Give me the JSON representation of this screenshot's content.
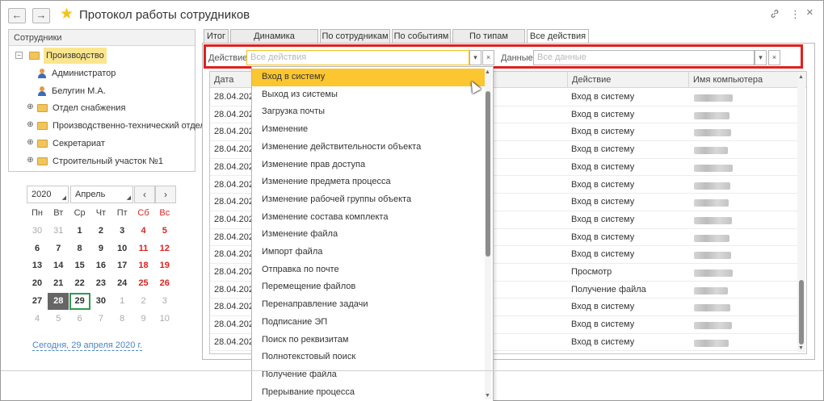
{
  "window": {
    "title": "Протокол работы сотрудников",
    "back_icon": "←",
    "forward_icon": "→",
    "link_icon": "🔗",
    "more_icon": "⋮",
    "close_icon": "×"
  },
  "tree": {
    "header": "Сотрудники",
    "items": [
      {
        "label": "Производство",
        "type": "folder",
        "expanded": true
      },
      {
        "label": "Администратор",
        "type": "user"
      },
      {
        "label": "Белугин М.А.",
        "type": "user"
      },
      {
        "label": "Отдел снабжения",
        "type": "folder"
      },
      {
        "label": "Производственно-технический отдел",
        "type": "folder"
      },
      {
        "label": "Секретариат",
        "type": "folder"
      },
      {
        "label": "Строительный участок №1",
        "type": "folder"
      }
    ]
  },
  "calendar": {
    "year": "2020",
    "month": "Апрель",
    "prev": "‹",
    "next": "›",
    "weekdays": [
      "Пн",
      "Вт",
      "Ср",
      "Чт",
      "Пт",
      "Сб",
      "Вс"
    ],
    "weeks": [
      [
        "30",
        "31",
        "1",
        "2",
        "3",
        "4",
        "5"
      ],
      [
        "6",
        "7",
        "8",
        "9",
        "10",
        "11",
        "12"
      ],
      [
        "13",
        "14",
        "15",
        "16",
        "17",
        "18",
        "19"
      ],
      [
        "20",
        "21",
        "22",
        "23",
        "24",
        "25",
        "26"
      ],
      [
        "27",
        "28",
        "29",
        "30",
        "1",
        "2",
        "3"
      ],
      [
        "4",
        "5",
        "6",
        "7",
        "8",
        "9",
        "10"
      ]
    ],
    "today_link": "Сегодня, 29 апреля 2020 г."
  },
  "tabs": [
    "Итог",
    "Динамика активности",
    "По сотрудникам",
    "По событиям",
    "По типам данных",
    "Все действия"
  ],
  "filters": {
    "action_label": "Действие:",
    "action_placeholder": "Все действия",
    "data_label": "Данные:",
    "data_placeholder": "Все данные",
    "dropdown_arrow": "▾",
    "clear": "×"
  },
  "table": {
    "columns": [
      "Дата",
      "Действие",
      "Имя компьютера"
    ],
    "rows": [
      {
        "date": "28.04.2020",
        "action": "Вход в систему"
      },
      {
        "date": "28.04.2020",
        "action": "Вход в систему"
      },
      {
        "date": "28.04.2020",
        "action": "Вход в систему"
      },
      {
        "date": "28.04.2020",
        "action": "Вход в систему"
      },
      {
        "date": "28.04.2020",
        "action": "Вход в систему"
      },
      {
        "date": "28.04.2020",
        "action": "Вход в систему"
      },
      {
        "date": "28.04.2020",
        "action": "Вход в систему"
      },
      {
        "date": "28.04.2020",
        "action": "Вход в систему"
      },
      {
        "date": "28.04.2020",
        "action": "Вход в систему"
      },
      {
        "date": "28.04.2020",
        "action": "Вход в систему"
      },
      {
        "date": "28.04.2020",
        "action": "Просмотр"
      },
      {
        "date": "28.04.2020",
        "action": "Получение файла"
      },
      {
        "date": "28.04.2020",
        "action": "Вход в систему"
      },
      {
        "date": "28.04.2020",
        "action": "Вход в систему"
      },
      {
        "date": "28.04.2020",
        "action": "Вход в систему"
      }
    ]
  },
  "dropdown": {
    "items": [
      "Вход в систему",
      "Выход из системы",
      "Загрузка почты",
      "Изменение",
      "Изменение действительности объекта",
      "Изменение прав доступа",
      "Изменение предмета процесса",
      "Изменение рабочей группы объекта",
      "Изменение состава комплекта",
      "Изменение файла",
      "Импорт файла",
      "Отправка по почте",
      "Перемещение файлов",
      "Перенаправление задачи",
      "Подписание ЭП",
      "Поиск по реквизитам",
      "Полнотекстовый поиск",
      "Получение файла",
      "Прерывание процесса"
    ],
    "highlighted": 0
  },
  "colors": {
    "accent": "#fbc62f",
    "red_frame": "#e21f1f",
    "link": "#4a86c5",
    "today_border": "#2e9c4b"
  }
}
